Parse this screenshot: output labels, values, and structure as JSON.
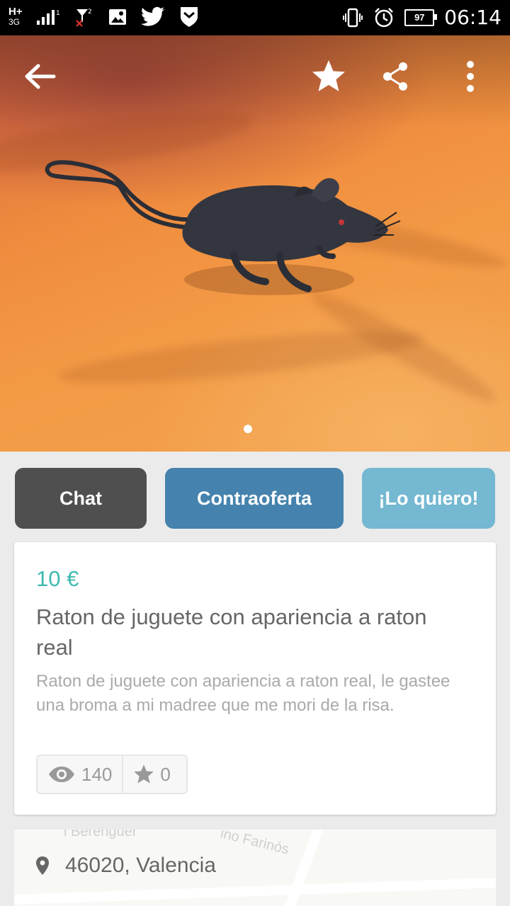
{
  "status_bar": {
    "network": "H+",
    "network_type": "3G",
    "signal_sub": "1",
    "sim2": "2",
    "battery": "97",
    "time": "06:14"
  },
  "colors": {
    "chat_button": "#4f4f4f",
    "counteroffer_button": "#4583ae",
    "want_button": "#74b8d1",
    "price": "#3cbab0"
  },
  "gallery": {
    "page_indicator_count": 1,
    "image": "black toy rat on orange bedsheet"
  },
  "actions": {
    "chat": "Chat",
    "counteroffer": "Contraoferta",
    "want": "¡Lo quiero!"
  },
  "product": {
    "price": "10 €",
    "title": "Raton de juguete con apariencia a raton real",
    "description": "Raton de juguete con apariencia a raton real, le gastee una broma a mi madree que me mori de la risa.",
    "views": "140",
    "favorites": "0"
  },
  "location": {
    "text": "46020, Valencia",
    "map_label_1": "l Berenguer",
    "map_label_2": "ino Farinós"
  }
}
